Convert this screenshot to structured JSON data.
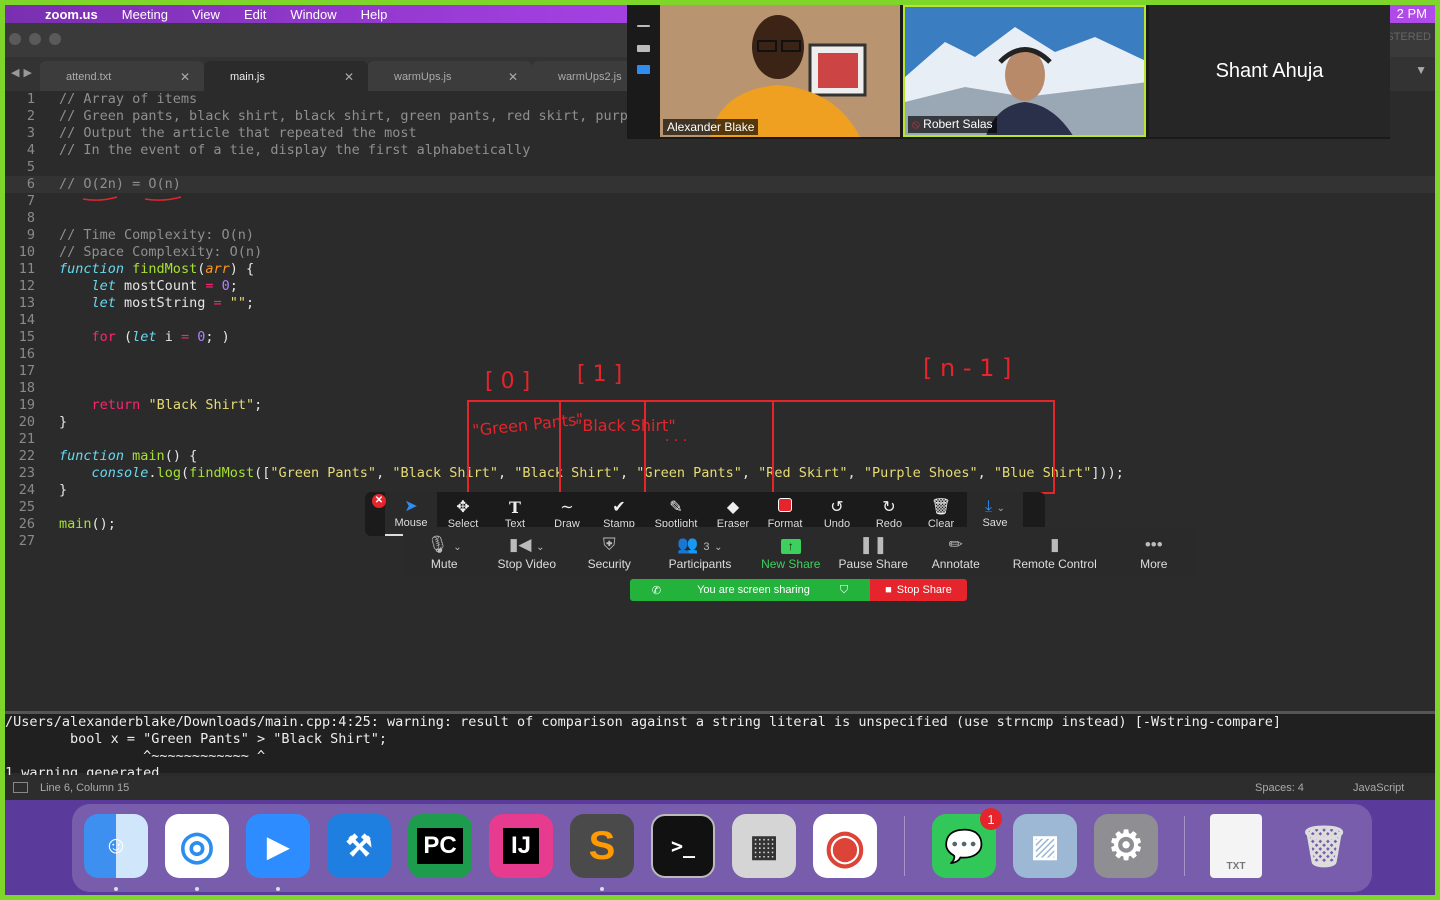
{
  "menubar": {
    "app": "zoom.us",
    "items": [
      "Meeting",
      "View",
      "Edit",
      "Window",
      "Help"
    ],
    "clock": "2 PM"
  },
  "window": {
    "label": "STERED"
  },
  "tabs": [
    {
      "label": "attend.txt"
    },
    {
      "label": "main.js"
    },
    {
      "label": "warmUps.js"
    },
    {
      "label": "warmUps2.js"
    }
  ],
  "code": {
    "numbers": [
      "1",
      "2",
      "3",
      "4",
      "5",
      "6",
      "7",
      "8",
      "9",
      "10",
      "11",
      "12",
      "13",
      "14",
      "15",
      "16",
      "17",
      "18",
      "19",
      "20",
      "21",
      "22",
      "23",
      "24",
      "25",
      "26",
      "27"
    ],
    "c1": "// Array of items",
    "c2": "// Green pants, black shirt, black shirt, green pants, red skirt, purpl",
    "c3": "// Output the article that repeated the most",
    "c4": "// In the event of a tie, display the first alphabetically",
    "c6": "// O(2n) = O(n)",
    "c9": "// Time Complexity: O(n)",
    "c10": "// Space Complexity: O(n)",
    "kw_function": "function",
    "kw_let": "let",
    "kw_for": "for",
    "kw_return": "return",
    "fn_findMost": "findMost",
    "param_arr": "arr",
    "var_mostCount": "mostCount",
    "var_mostString": "mostString",
    "eq": "=",
    "zero": "0",
    "empty_str": "\"\"",
    "var_i": "i",
    "black_shirt": "\"Black Shirt\"",
    "fn_main": "main",
    "console": "console",
    "log": "log",
    "arr_items": [
      "\"Green Pants\"",
      "\"Black Shirt\"",
      "\"Black Shirt\"",
      "\"Green Pants\"",
      "\"Red Skirt\"",
      "\"Purple Shoes\"",
      "\"Blue Shirt\""
    ]
  },
  "annotations": {
    "idx0": "[ 0 ]",
    "idx1": "[ 1 ]",
    "idxn": "[ n - 1 ]",
    "cell0": "\"Green Pants\"",
    "cell1": "\"Black Shirt\"",
    "dots": ". . ."
  },
  "draw_toolbar": {
    "tools": [
      "Mouse",
      "Select",
      "Draw",
      "Stamp",
      "Spotlight",
      "Eraser",
      "Format",
      "Undo",
      "Redo",
      "Clear",
      "Save"
    ],
    "text_tool": "Text"
  },
  "meeting_toolbar": {
    "mute": "Mute",
    "stop_video": "Stop Video",
    "security": "Security",
    "participants": "Participants",
    "participants_count": "3",
    "new_share": "New Share",
    "pause_share": "Pause Share",
    "annotate": "Annotate",
    "remote_control": "Remote Control",
    "more": "More"
  },
  "share_status": {
    "sharing": "You are screen sharing",
    "stop": "Stop Share"
  },
  "participants": [
    {
      "name": "Alexander Blake"
    },
    {
      "name": "Robert Salas"
    },
    {
      "name": "Shant Ahuja"
    }
  ],
  "console": {
    "line1": "/Users/alexanderblake/Downloads/main.cpp:4:25: warning: result of comparison against a string literal is unspecified (use strncmp instead) [-Wstring-compare]",
    "line2": "        bool x = \"Green Pants\" > \"Black Shirt\";",
    "line3": "                 ^~~~~~~~~~~~~ ^",
    "line4": "1 warning generated."
  },
  "status": {
    "position": "Line 6, Column 15",
    "spaces": "Spaces: 4",
    "language": "JavaScript"
  },
  "dock": {
    "pycharm": "PC",
    "intellij": "IJ",
    "messages_badge": "1",
    "textedit_label": "TXT"
  }
}
